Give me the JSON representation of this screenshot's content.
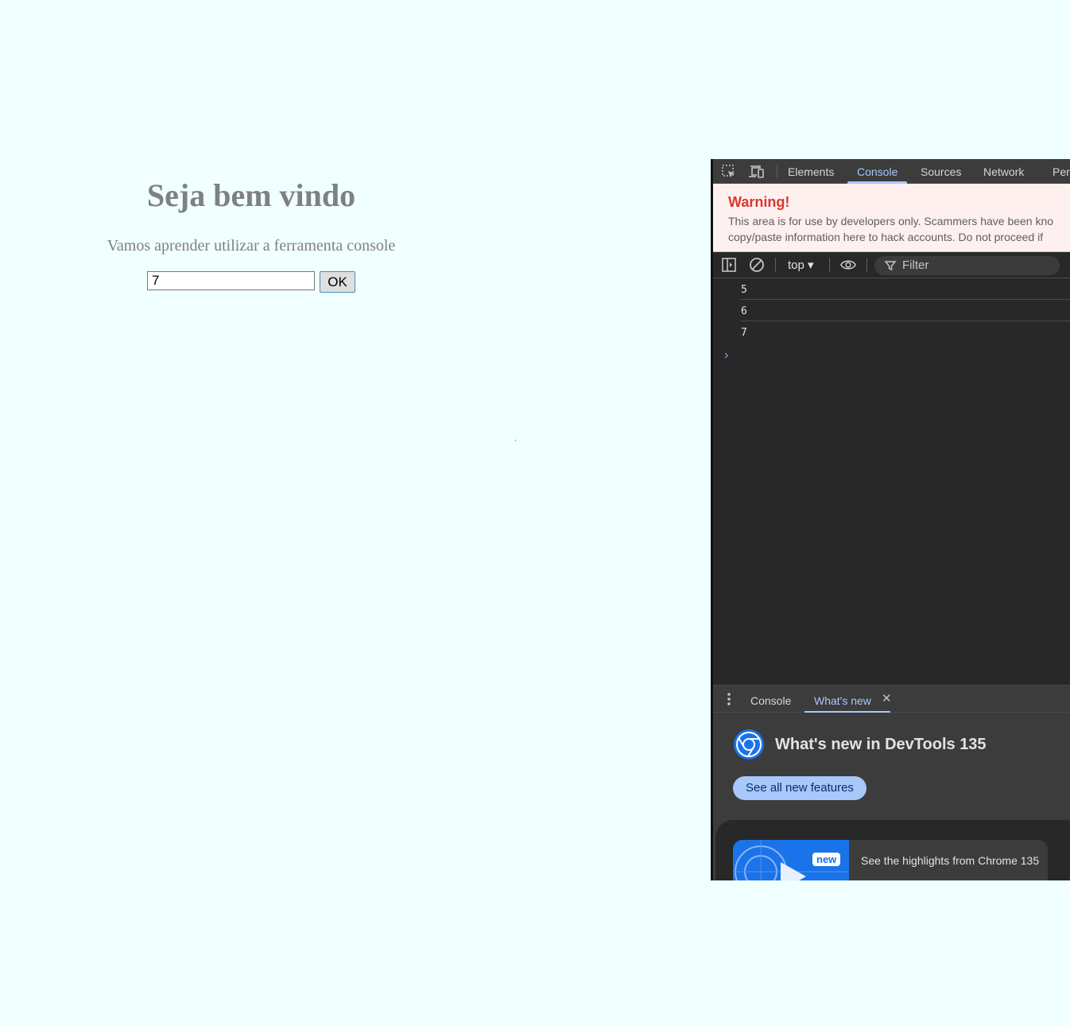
{
  "page": {
    "title": "Seja bem vindo",
    "subtitle": "Vamos aprender utilizar a ferramenta console",
    "input_value": "7",
    "ok_label": "OK"
  },
  "devtools": {
    "tabs": [
      "Elements",
      "Console",
      "Sources",
      "Network",
      "Perf"
    ],
    "active_tab": "Console",
    "warning": {
      "title": "Warning!",
      "line1": "This area is for use by developers only. Scammers have been kno",
      "line2": "copy/paste information here to hack accounts. Do not proceed if"
    },
    "toolbar": {
      "context": "top ▾",
      "filter_placeholder": "Filter"
    },
    "console_output": [
      "5",
      "6",
      "7"
    ],
    "prompt": "›",
    "drawer": {
      "tabs": [
        "Console",
        "What's new"
      ],
      "active_tab": "What's new",
      "close": "✕"
    },
    "whats_new": {
      "title": "What's new in DevTools 135",
      "button": "See all new features",
      "badge": "new",
      "card_text": "See the highlights from Chrome 135"
    }
  },
  "colors": {
    "page_bg": "#f0ffff",
    "devtools_bg": "#282828",
    "accent": "#a8c7fa",
    "warning_red": "#dc362e"
  },
  "icons": [
    "select-element-icon",
    "device-toolbar-icon",
    "sidebar-toggle-icon",
    "clear-console-icon",
    "eye-icon",
    "filter-icon",
    "kebab-menu-icon",
    "chrome-devtools-icon",
    "play-icon"
  ]
}
